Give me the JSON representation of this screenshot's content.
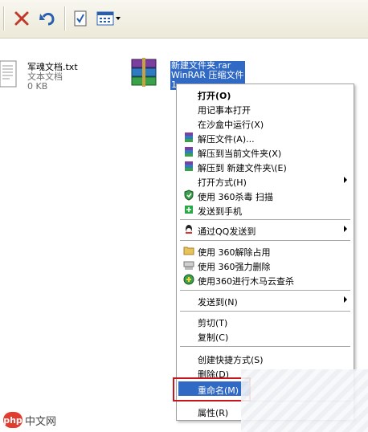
{
  "toolbar": {
    "delete_icon": "x-icon",
    "undo_icon": "undo-icon",
    "properties_icon": "properties-icon",
    "views_icon": "views-icon"
  },
  "files": [
    {
      "name": "军魂文档.txt",
      "type": "文本文档",
      "size": "0 KB",
      "icon": "text-file-icon"
    },
    {
      "name": "新建文件夹.rar",
      "type": "WinRAR 压缩文件",
      "size": "1",
      "icon": "winrar-archive-icon"
    }
  ],
  "menu": {
    "items": [
      {
        "label": "打开(O)",
        "bold": true,
        "icon": ""
      },
      {
        "label": "用记事本打开",
        "icon": ""
      },
      {
        "label": "在沙盒中运行(X)",
        "icon": ""
      },
      {
        "label": "解压文件(A)...",
        "icon": "winrar-icon"
      },
      {
        "label": "解压到当前文件夹(X)",
        "icon": "winrar-icon"
      },
      {
        "label": "解压到 新建文件夹\\(E)",
        "icon": "winrar-icon"
      },
      {
        "label": "打开方式(H)",
        "icon": "",
        "submenu": true
      },
      {
        "label": "使用 360杀毒 扫描",
        "icon": "360-shield-icon"
      },
      {
        "label": "发送到手机",
        "icon": "phone-icon"
      },
      {
        "label": "通过QQ发送到",
        "icon": "qq-icon",
        "submenu": true
      },
      {
        "label": "使用 360解除占用",
        "icon": "folder-unlock-icon"
      },
      {
        "label": "使用 360强力删除",
        "icon": "shredder-icon"
      },
      {
        "label": "使用360进行木马云查杀",
        "icon": "360-green-icon"
      },
      {
        "label": "发送到(N)",
        "icon": "",
        "submenu": true
      },
      {
        "label": "剪切(T)",
        "icon": ""
      },
      {
        "label": "复制(C)",
        "icon": ""
      },
      {
        "label": "创建快捷方式(S)",
        "icon": ""
      },
      {
        "label": "删除(D)",
        "icon": ""
      },
      {
        "label": "重命名(M)",
        "icon": "",
        "highlighted": true
      },
      {
        "label": "属性(R)",
        "icon": ""
      }
    ]
  },
  "watermark": {
    "logo": "php",
    "text": "中文网"
  },
  "colors": {
    "selection": "#316ac5",
    "highlight_box": "#c4161c"
  }
}
